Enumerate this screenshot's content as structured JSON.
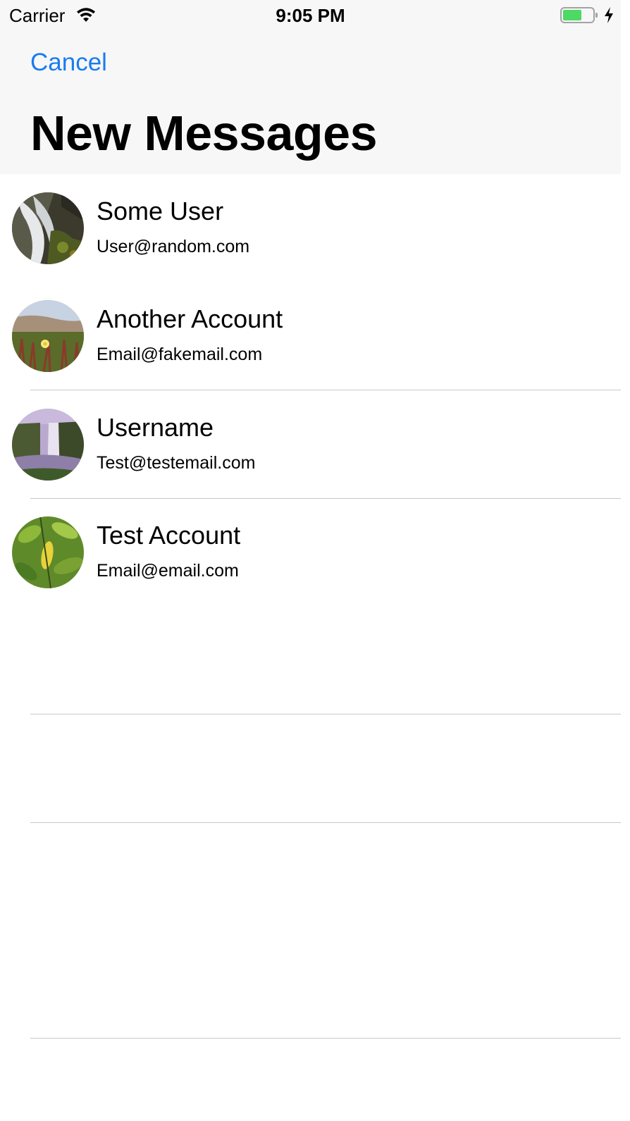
{
  "status_bar": {
    "carrier": "Carrier",
    "time": "9:05 PM",
    "battery_color": "#4cd964",
    "icons": [
      "wifi-icon",
      "battery-icon",
      "charging-icon"
    ]
  },
  "nav": {
    "cancel_label": "Cancel",
    "title": "New Messages",
    "accent_color": "#1a7cf0"
  },
  "contacts": [
    {
      "name": "Some User",
      "email": "User@random.com",
      "avatar": "waterfall-rocks-photo"
    },
    {
      "name": "Another Account",
      "email": "Email@fakemail.com",
      "avatar": "flower-field-photo"
    },
    {
      "name": "Username",
      "email": "Test@testemail.com",
      "avatar": "misty-waterfall-photo"
    },
    {
      "name": "Test Account",
      "email": "Email@email.com",
      "avatar": "green-leaves-photo"
    }
  ]
}
